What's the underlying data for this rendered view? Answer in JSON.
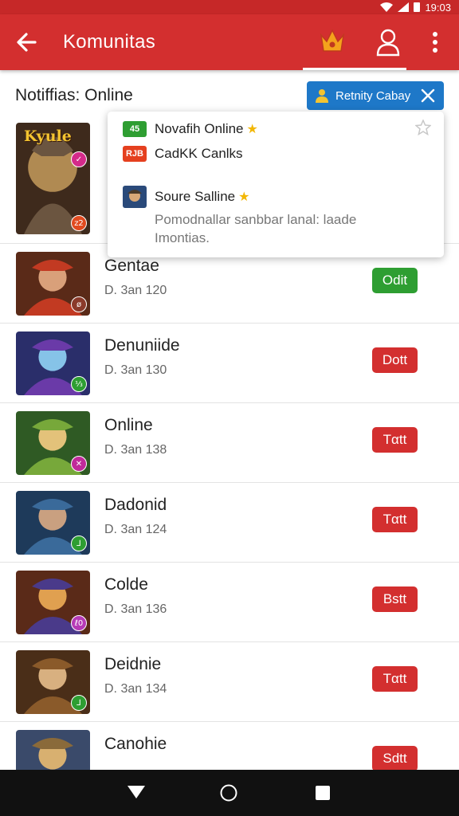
{
  "status_bar": {
    "time": "19:03",
    "icons": [
      "wifi-icon",
      "signal-icon",
      "battery-icon"
    ]
  },
  "app_bar": {
    "title": "Komunitas",
    "icons": [
      "back-arrow-icon",
      "crown-icon",
      "user-icon",
      "more-vert-icon"
    ]
  },
  "subheader": {
    "label": "Notiffias: Online"
  },
  "chip": {
    "label": "Retnity Cabay",
    "icons": [
      "user-icon",
      "close-icon"
    ]
  },
  "popup": {
    "line1": {
      "tag": "45",
      "text": "Novafih Online"
    },
    "line2": {
      "tag": "RJB",
      "text": "CadKK Canlks"
    },
    "line3": {
      "text": "Soure Salline"
    },
    "description": "Pomodnallar sanbbar lanal: laade Imontias."
  },
  "list_items": [
    {
      "name": "Kyule",
      "sub": "",
      "button": "",
      "badge": "✓",
      "badge_color": "#d42a8a",
      "badge2": "z2",
      "badge2_color": "#e04a1f",
      "thumb_colors": [
        "#3e2a1c",
        "#6b5540",
        "#b08a52"
      ]
    },
    {
      "name": "Gentae",
      "sub": "D. 3an 120",
      "button": "Odit",
      "button_color": "#2e9e32",
      "badge": "ø",
      "badge_color": "#8b3a2a",
      "thumb_colors": [
        "#5a2a18",
        "#c23a22",
        "#d9a07a"
      ]
    },
    {
      "name": "Denuniide",
      "sub": "D. 3an 130",
      "button": "Dott",
      "button_color": "#d32f2f",
      "badge": "⅓",
      "badge_color": "#2e9e32",
      "thumb_colors": [
        "#2a2e6a",
        "#6a3aa8",
        "#86c3e8"
      ]
    },
    {
      "name": "Online",
      "sub": "D. 3an 138",
      "button": "Tαtt",
      "button_color": "#d32f2f",
      "badge": "✕",
      "badge_color": "#c02a9a",
      "thumb_colors": [
        "#2f5a24",
        "#77a83a",
        "#e3c27a"
      ]
    },
    {
      "name": "Dadonid",
      "sub": "D. 3an 124",
      "button": "Tαtt",
      "button_color": "#d32f2f",
      "badge": "⅃",
      "badge_color": "#2e9e32",
      "thumb_colors": [
        "#1e3a5a",
        "#3a6a9a",
        "#c9a080"
      ]
    },
    {
      "name": "Colde",
      "sub": "D. 3an 136",
      "button": "Bstt",
      "button_color": "#d32f2f",
      "badge": "ℓ0",
      "badge_color": "#b63ab6",
      "thumb_colors": [
        "#5a2a18",
        "#4a3a8a",
        "#e0a050"
      ]
    },
    {
      "name": "Deidnie",
      "sub": "D. 3an 134",
      "button": "Tαtt",
      "button_color": "#d32f2f",
      "badge": "⅃",
      "badge_color": "#2e9e32",
      "thumb_colors": [
        "#4a2e18",
        "#8a5a2a",
        "#d8b080"
      ]
    },
    {
      "name": "Canohie",
      "sub": "",
      "button": "Sdtt",
      "button_color": "#d32f2f",
      "badge": "",
      "badge_color": "#2e9e32",
      "thumb_colors": [
        "#3a4a6a",
        "#8a6a3a",
        "#d8b070"
      ]
    }
  ],
  "nav_bar": {
    "icons": [
      "nav-back-icon",
      "nav-home-icon",
      "nav-recents-icon"
    ]
  }
}
